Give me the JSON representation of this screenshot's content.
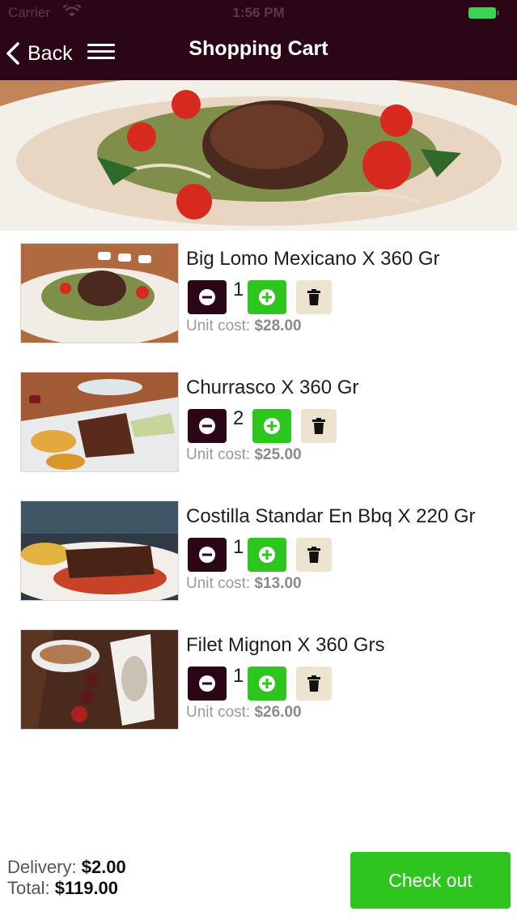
{
  "status_bar": {
    "carrier": "Carrier",
    "time": "1:56 PM"
  },
  "header": {
    "back_label": "Back",
    "title": "Shopping Cart"
  },
  "cart": {
    "unit_cost_label": "Unit cost:",
    "items": [
      {
        "name": "Big Lomo Mexicano X 360 Gr",
        "quantity": "1",
        "unit_cost": "$28.00"
      },
      {
        "name": "Churrasco X 360 Gr",
        "quantity": "2",
        "unit_cost": "$25.00"
      },
      {
        "name": "Costilla Standar En Bbq X 220 Gr",
        "quantity": "1",
        "unit_cost": "$13.00"
      },
      {
        "name": "Filet Mignon X 360 Grs",
        "quantity": "1",
        "unit_cost": "$26.00"
      }
    ]
  },
  "footer": {
    "delivery_label": "Delivery:",
    "delivery_value": "$2.00",
    "total_label": "Total:",
    "total_value": "$119.00",
    "checkout_label": "Check out"
  },
  "colors": {
    "header_bg": "#2b0617",
    "accent_green": "#2ec51f",
    "delete_bg": "#ede4cf"
  },
  "icons": [
    "chevron-left-icon",
    "hamburger-icon",
    "minus-circle-icon",
    "plus-circle-icon",
    "trash-icon",
    "wifi-icon",
    "battery-icon"
  ]
}
